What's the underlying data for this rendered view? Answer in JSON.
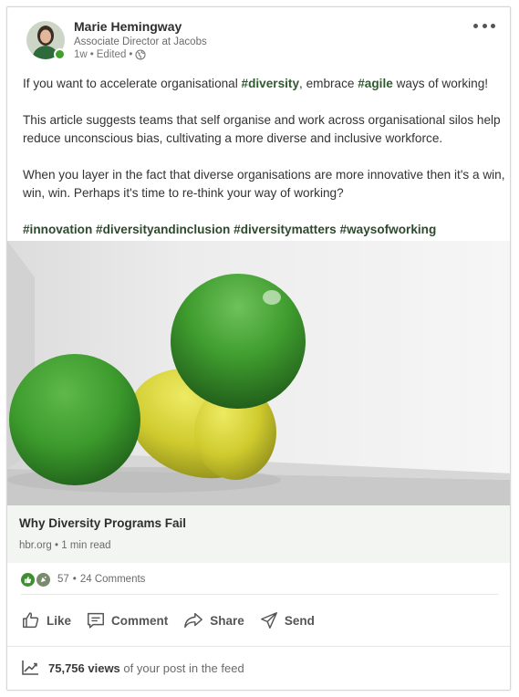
{
  "author": {
    "name": "Marie Hemingway",
    "title": "Associate Director at Jacobs",
    "time": "1w",
    "edited": "Edited",
    "separator": "•",
    "visibility_icon": "globe-icon"
  },
  "post": {
    "line1_prefix": "If you want to accelerate organisational ",
    "tag_diversity": "#diversity",
    "line1_mid": ", embrace ",
    "tag_agile": "#agile",
    "line1_suffix": " ways of working!",
    "paragraph2": "This article suggests teams that self organise and work across organisational silos help reduce unconscious bias, cultivating a more diverse and inclusive workforce.",
    "paragraph3": "When you layer in the fact that diverse organisations are more innovative then it's a win, win, win. Perhaps it's time to re-think your way of working?",
    "hashtags": "#innovation #diversityandinclusion #diversitymatters #waysofworking"
  },
  "article": {
    "title": "Why Diversity Programs Fail",
    "source": "hbr.org",
    "read_time": "1 min read"
  },
  "social": {
    "reactions_count": "57",
    "comments": "24 Comments",
    "reaction_icons": [
      "like-icon",
      "celebrate-icon"
    ]
  },
  "actions": {
    "like": "Like",
    "comment": "Comment",
    "share": "Share",
    "send": "Send"
  },
  "views": {
    "count": "75,756 views",
    "suffix": "of your post in the feed"
  },
  "colors": {
    "green_ball": "#3f9a2c",
    "yellow_ball": "#d9d43a",
    "tag_text": "#2e5c2e",
    "online": "#3fa02b"
  }
}
